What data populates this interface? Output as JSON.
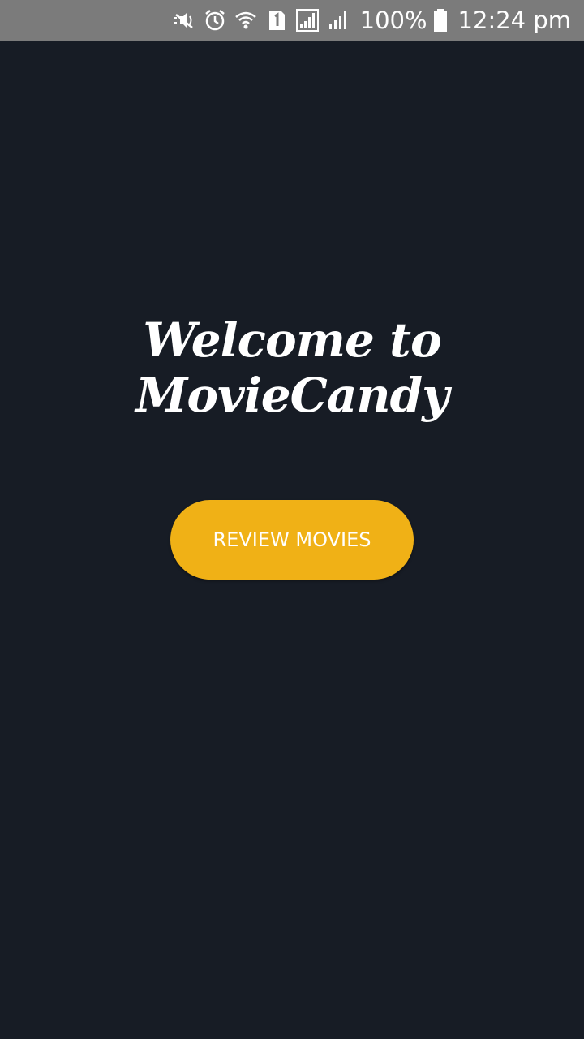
{
  "status_bar": {
    "icons": [
      "mute-icon",
      "alarm-icon",
      "wifi-icon",
      "sim-1-icon",
      "signal-icon",
      "signal-2-icon"
    ],
    "battery_text": "100%",
    "battery_icon": "battery-full-icon",
    "time": "12:24 pm"
  },
  "main": {
    "title": "Welcome to MovieCandy",
    "review_button_label": "REVIEW MOVIES"
  },
  "colors": {
    "background": "#171c25",
    "status_bar": "#7b7b7b",
    "button": "#f0b116",
    "text": "#ffffff"
  }
}
